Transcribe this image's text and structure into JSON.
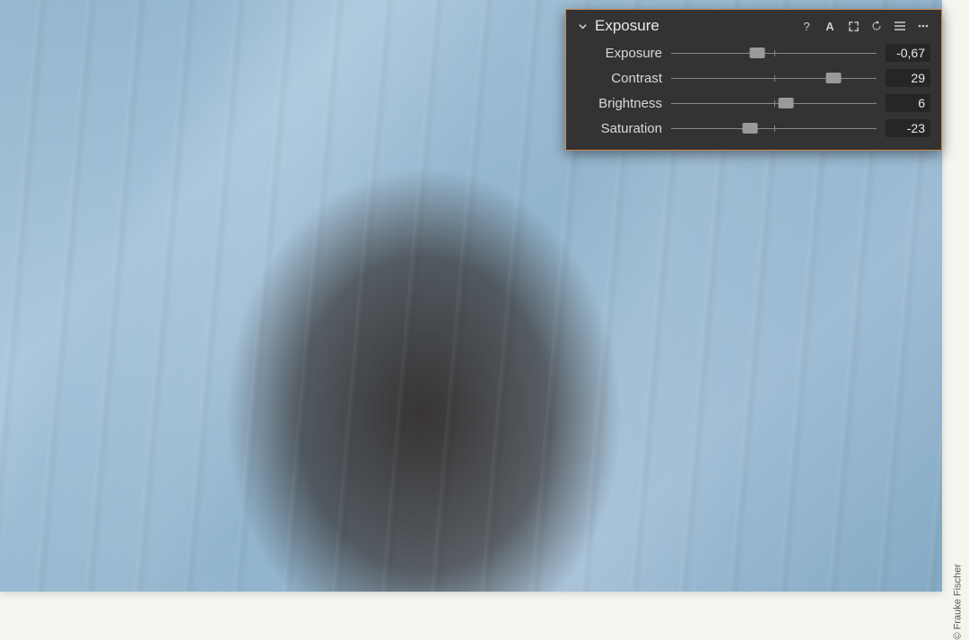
{
  "credit": "© Frauke Fischer",
  "panel": {
    "title": "Exposure",
    "sliders": [
      {
        "label": "Exposure",
        "value": "-0,67",
        "thumb_pct": 42,
        "range": [
          -4,
          4
        ]
      },
      {
        "label": "Contrast",
        "value": "29",
        "thumb_pct": 79,
        "range": [
          -50,
          50
        ]
      },
      {
        "label": "Brightness",
        "value": "6",
        "thumb_pct": 56,
        "range": [
          -50,
          50
        ]
      },
      {
        "label": "Saturation",
        "value": "-23",
        "thumb_pct": 38.5,
        "range": [
          -100,
          100
        ]
      }
    ]
  }
}
